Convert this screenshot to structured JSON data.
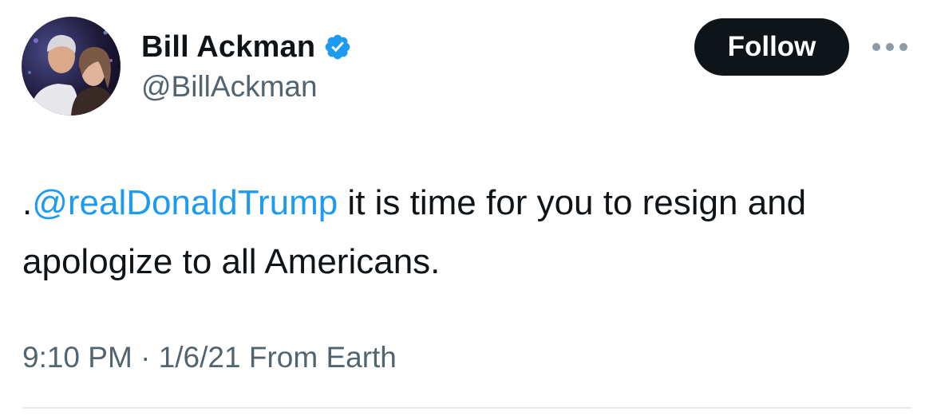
{
  "author": {
    "display_name": "Bill Ackman",
    "handle": "@BillAckman",
    "verified_icon": "verified-badge-icon",
    "avatar_icon": "avatar-photo"
  },
  "actions": {
    "follow_label": "Follow",
    "more_icon": "more-options-icon"
  },
  "tweet": {
    "prefix": ".",
    "mention": "@realDonaldTrump",
    "body": " it is time for you to resign and apologize to all Americans."
  },
  "meta": {
    "time": "9:10 PM",
    "separator": " · ",
    "date": "1/6/21",
    "source": " From Earth"
  },
  "colors": {
    "link": "#1d9bf0",
    "secondary_text": "#536471",
    "primary_text": "#0f1419",
    "follow_button_bg": "#0f1419",
    "verified_badge": "#1d9bf0"
  }
}
